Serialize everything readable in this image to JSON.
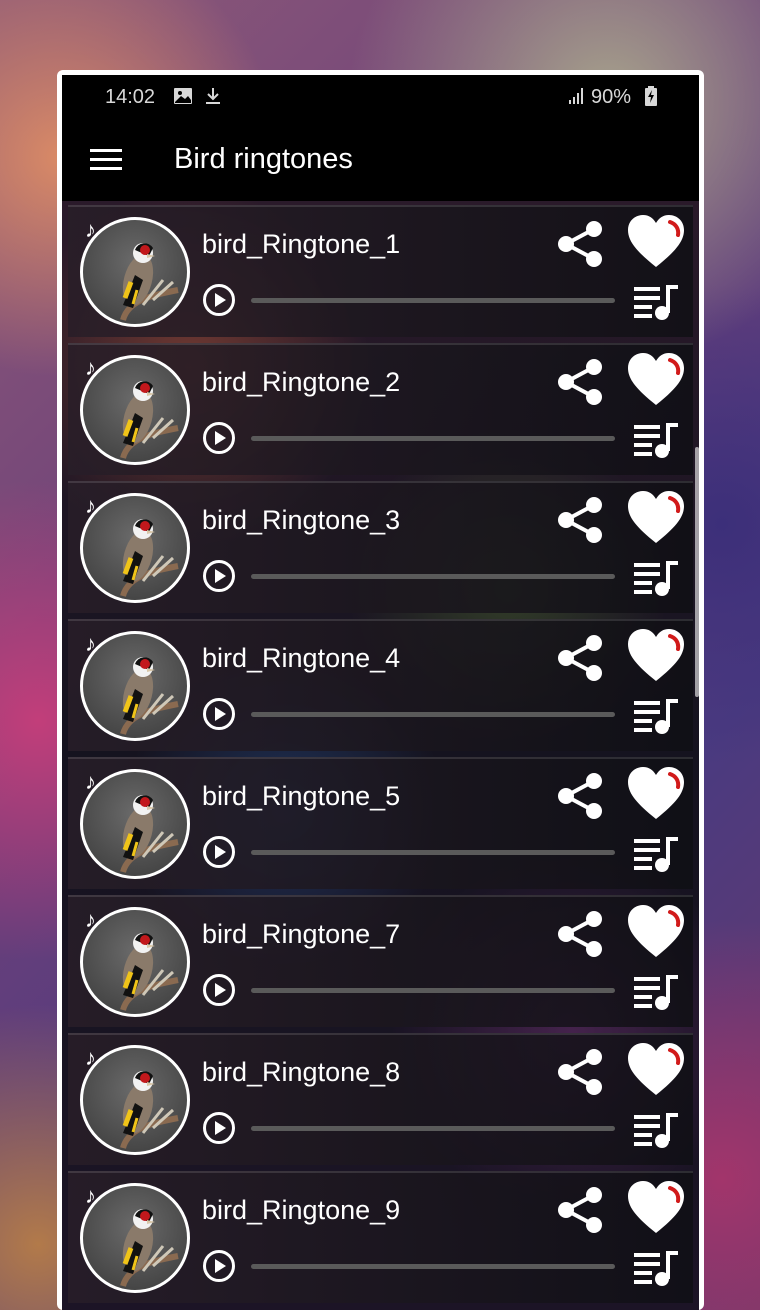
{
  "status_bar": {
    "time": "14:02",
    "battery": "90%",
    "icons": [
      "image-icon",
      "download-icon",
      "signal-icon",
      "battery-charging-icon"
    ]
  },
  "app_bar": {
    "title": "Bird ringtones",
    "menu_icon": "hamburger-menu-icon"
  },
  "ringtones": [
    {
      "title": "bird_Ringtone_1",
      "progress": 0
    },
    {
      "title": "bird_Ringtone_2",
      "progress": 0
    },
    {
      "title": "bird_Ringtone_3",
      "progress": 0
    },
    {
      "title": "bird_Ringtone_4",
      "progress": 0
    },
    {
      "title": "bird_Ringtone_5",
      "progress": 0
    },
    {
      "title": "bird_Ringtone_7",
      "progress": 0
    },
    {
      "title": "bird_Ringtone_8",
      "progress": 0
    },
    {
      "title": "bird_Ringtone_9",
      "progress": 0
    }
  ],
  "row_icons": {
    "avatar": "goldfinch-image",
    "note": "music-note-icon",
    "play": "play-icon",
    "share": "share-icon",
    "favorite": "heart-icon",
    "playlist": "playlist-icon"
  },
  "colors": {
    "app_bar": "#000000",
    "text": "#ffffff",
    "heart_accent": "#d11a1a"
  }
}
